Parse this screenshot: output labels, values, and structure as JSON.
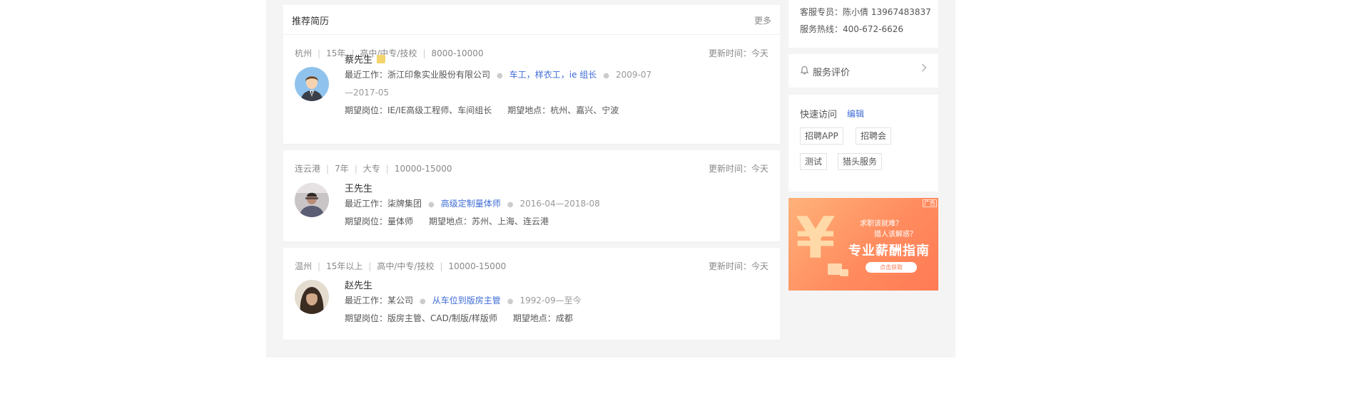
{
  "header": {
    "title": "推荐简历",
    "more": "更多"
  },
  "resumes": [
    {
      "meta": [
        "杭州",
        "15年",
        "高中/中专/技校",
        "8000-10000"
      ],
      "update": "更新时间：今天",
      "name": "蔡先生",
      "work_label": "最近工作：浙江印象实业股份有限公司",
      "position": "车工，样衣工，ie 组长",
      "period_a": "2009-07",
      "period_b": "—2017-05",
      "expect_job": "期望岗位：IE/IE高级工程师、车间组长",
      "expect_place": "期望地点：杭州、嘉兴、宁波"
    },
    {
      "meta": [
        "连云港",
        "7年",
        "大专",
        "10000-15000"
      ],
      "update": "更新时间：今天",
      "name": "王先生",
      "work_label": "最近工作：柒牌集团",
      "position": "高级定制量体师",
      "period_a": "2016-04—2018-08",
      "expect_job": "期望岗位：量体师",
      "expect_place": "期望地点：苏州、上海、连云港"
    },
    {
      "meta": [
        "温州",
        "15年以上",
        "高中/中专/技校",
        "10000-15000"
      ],
      "update": "更新时间：今天",
      "name": "赵先生",
      "work_label": "最近工作：某公司",
      "position": "从车位到版房主管",
      "period_a": "1992-09—至今",
      "expect_job": "期望岗位：版房主管、CAD/制版/样版师",
      "expect_place": "期望地点：成都"
    }
  ],
  "sidebar": {
    "service_person": "客服专员：陈小倩 13967483837",
    "service_phone": "服务热线：400-672-6626",
    "eval": "服务评价",
    "quick_title": "快速访问",
    "quick_edit": "编辑",
    "quick_tags": [
      "招聘APP",
      "招聘会",
      "测试",
      "猎头服务"
    ]
  },
  "ad": {
    "line1": "求职该就难？",
    "line2": "猎人该解惑？",
    "headline": "专业薪酬指南",
    "button": "点击获取",
    "tag": "广告"
  },
  "colors": {
    "accent": "#3e6cd6",
    "badge": "#f3d56c",
    "ad_start": "#ffb27a",
    "ad_end": "#ff7a55"
  },
  "icons": {
    "eval": "bell-icon",
    "chevron": "chevron-right-icon",
    "vip": "vip-badge-icon"
  }
}
